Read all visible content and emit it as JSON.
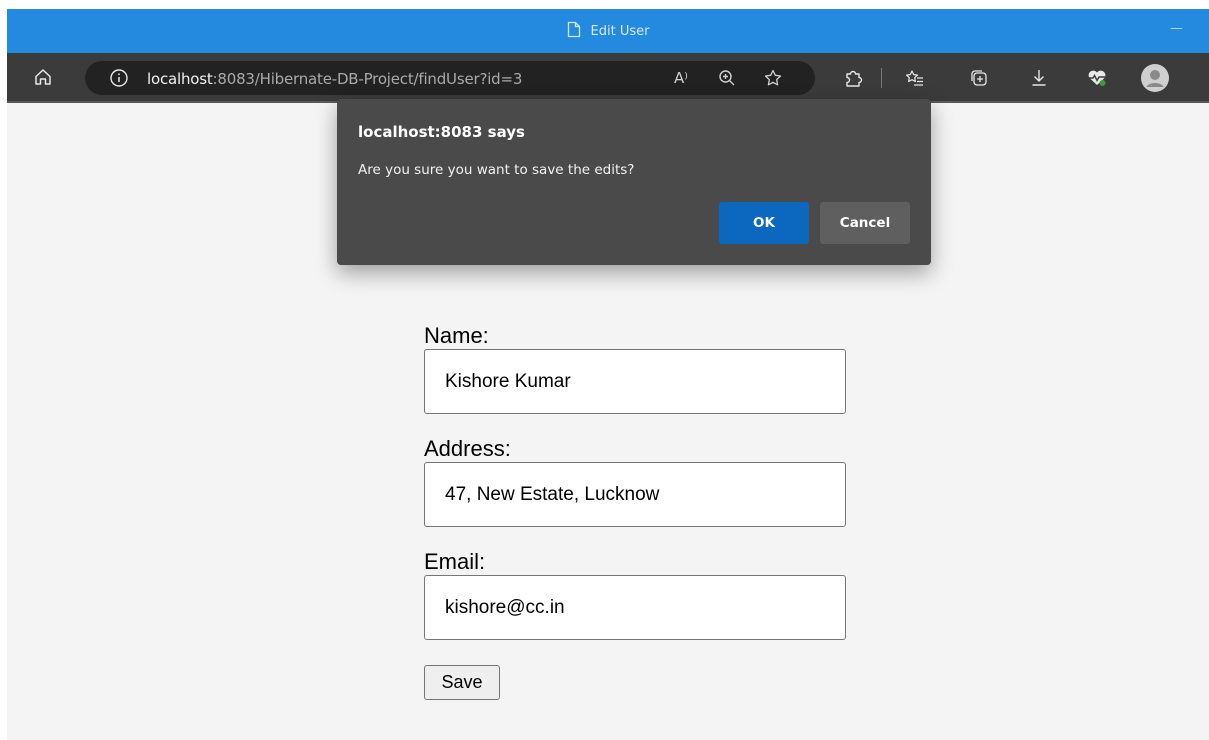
{
  "window": {
    "title": "Edit User",
    "minimize_glyph": "—"
  },
  "browser": {
    "url_host": "localhost",
    "url_rest": ":8083/Hibernate-DB-Project/findUser?id=3",
    "read_aloud_glyph": "A⁾",
    "icons": [
      "home-icon",
      "info-icon",
      "read-aloud-icon",
      "zoom-icon",
      "favorite-star-icon",
      "extensions-icon",
      "favorites-list-icon",
      "collections-icon",
      "downloads-icon",
      "health-icon",
      "profile-avatar-icon"
    ]
  },
  "dialog": {
    "title": "localhost:8083 says",
    "message": "Are you sure you want to save the edits?",
    "ok_label": "OK",
    "cancel_label": "Cancel"
  },
  "form": {
    "name_label": "Name:",
    "name_value": "Kishore Kumar",
    "address_label": "Address:",
    "address_value": "47, New Estate, Lucknow",
    "email_label": "Email:",
    "email_value": "kishore@cc.in",
    "save_label": "Save"
  },
  "colors": {
    "titlebar": "#238ae0",
    "toolbar": "#3b3b3b",
    "dialog_bg": "#4a4a4a",
    "ok_button": "#0c67bf"
  }
}
